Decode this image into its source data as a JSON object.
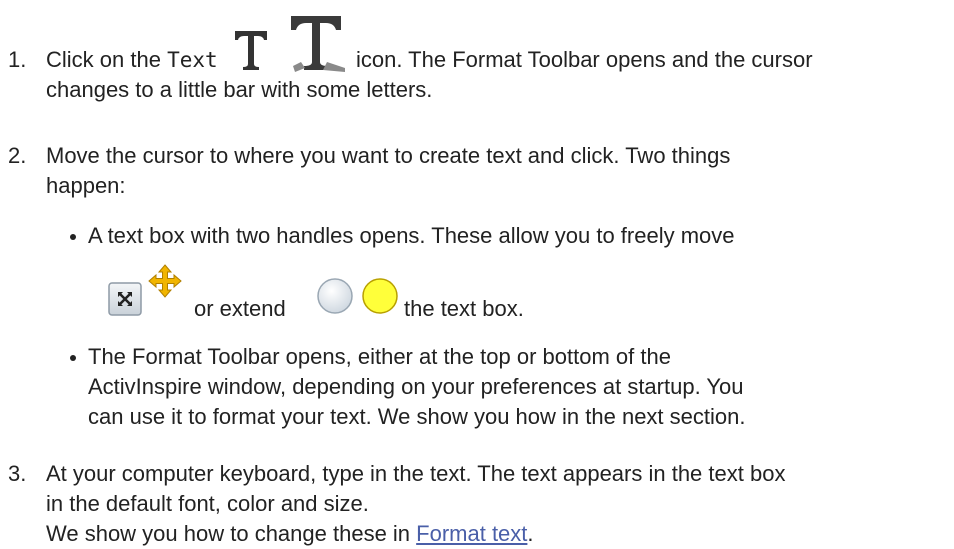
{
  "steps": [
    {
      "number": "1.",
      "part1": "Click on the ",
      "text_word": "Text",
      "part2": " icon. The Format Toolbar opens and the cursor",
      "line2": "changes to a little bar with some letters."
    },
    {
      "number": "2.",
      "line1": "Move the cursor to where you want to create text and click. Two things",
      "line2": "happen:",
      "bullets": [
        {
          "line1": "A text box with two handles opens. These allow you to freely move",
          "mid": "or extend",
          "end": "the text box."
        },
        {
          "line1": "The Format Toolbar opens, either at the top or bottom of the",
          "line2": "ActivInspire window, depending on your preferences at startup. You",
          "line3": "can use it to format your text. We show you how in the next section."
        }
      ]
    },
    {
      "number": "3.",
      "line1": "At your computer keyboard, type in the text. The text appears in the text box",
      "line2": "in the default font, color and size.",
      "line3_prefix": "We show you how to change these in ",
      "link": "Format text",
      "line3_suffix": "."
    }
  ],
  "icons": {
    "text_small": "text-t-small-icon",
    "text_large": "text-t-large-icon",
    "move_box": "move-box-icon",
    "move_arrows": "move-arrows-icon",
    "extend_grey": "extend-handle-grey-icon",
    "extend_yellow": "extend-handle-yellow-icon"
  },
  "colors": {
    "link": "#4a5fa8",
    "yellow_handle": "#ffff3a",
    "arrows": "#f1b500"
  }
}
